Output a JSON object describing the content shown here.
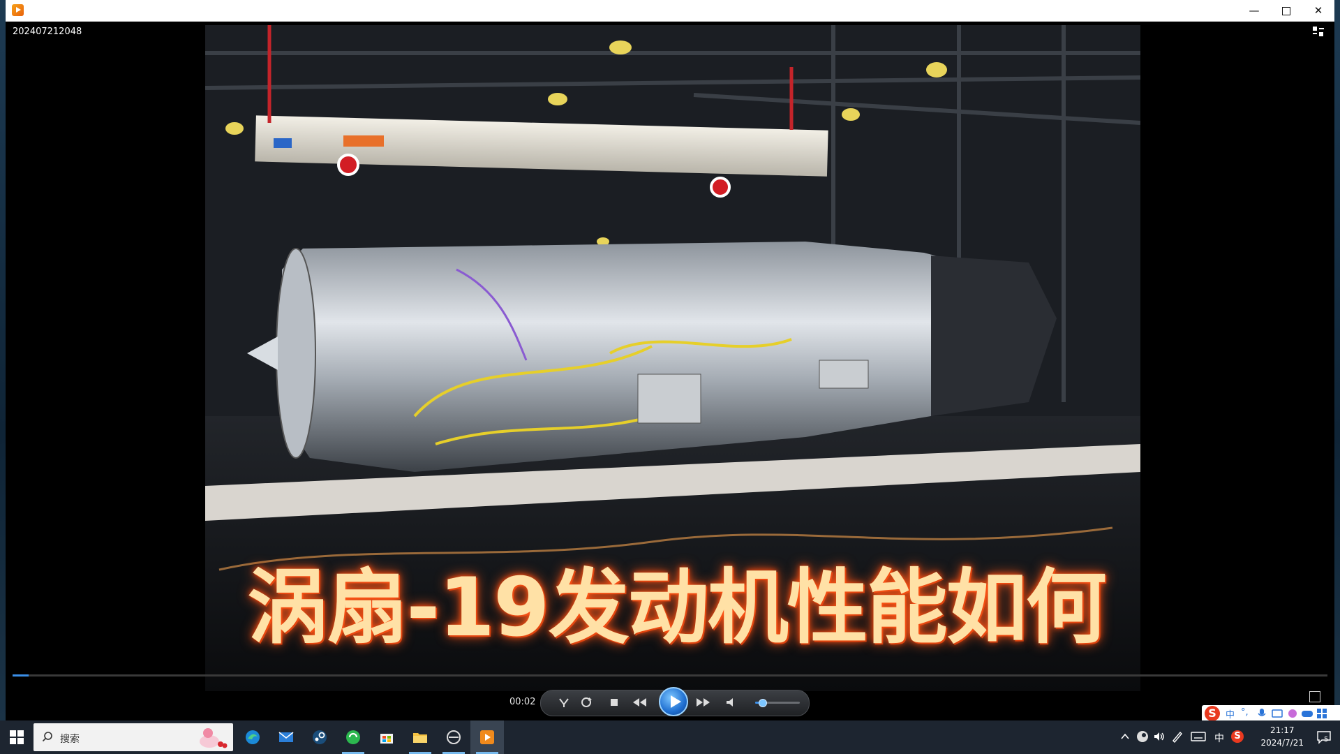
{
  "window": {
    "video_title": "202407212048",
    "minimize_glyph": "—",
    "close_glyph": "✕"
  },
  "video": {
    "caption": "涡扇-19发动机性能如何"
  },
  "player": {
    "elapsed_time": "00:02",
    "progress_fraction": 0.012,
    "volume_fraction": 0.15
  },
  "ime": {
    "logo": "S",
    "mode": "中",
    "punct": "°,"
  },
  "taskbar": {
    "search_placeholder": "搜索",
    "apps": [
      {
        "name": "edge-icon"
      },
      {
        "name": "mail-icon"
      },
      {
        "name": "steam-icon"
      },
      {
        "name": "green-app-icon"
      },
      {
        "name": "store-icon"
      },
      {
        "name": "file-explorer-icon"
      },
      {
        "name": "dev-app-icon"
      },
      {
        "name": "video-player-icon"
      }
    ],
    "tray": {
      "ime_mode": "中",
      "ime_logo": "S",
      "time": "21:17",
      "date": "2024/7/21",
      "notification_count": "5"
    }
  },
  "colors": {
    "accent": "#3b8fe8",
    "caption_glow": "#ff5a1a",
    "caption_fill": "#ffe1a6",
    "taskbar": "#1d2530"
  }
}
